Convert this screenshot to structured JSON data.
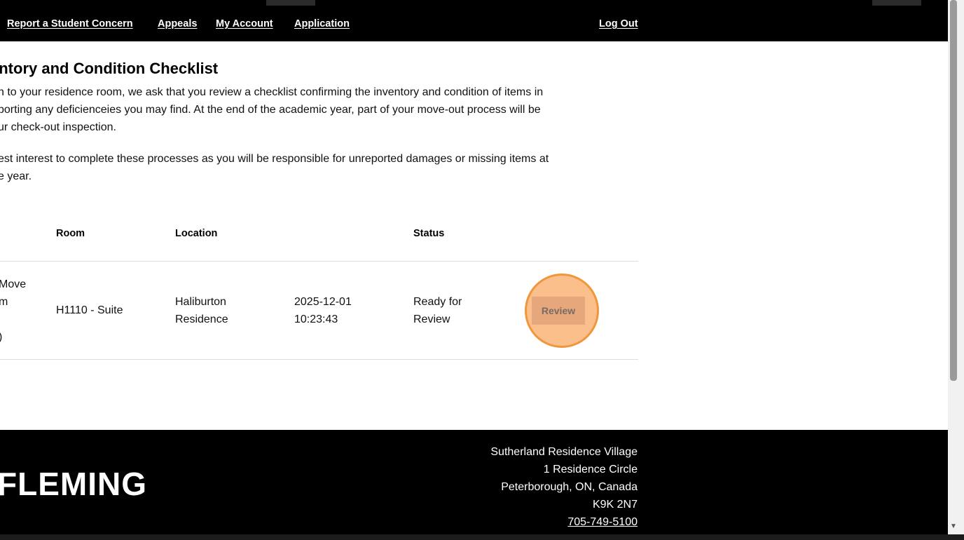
{
  "nav": {
    "report": "Report a Student Concern",
    "appeals": "Appeals",
    "account": "My Account",
    "application": "Application",
    "logout": "Log Out"
  },
  "page": {
    "title": "entory and Condition Checklist",
    "p1_l1": "n to your residence room, we ask that you review a checklist confirming the inventory and condition of items in",
    "p1_l2": "porting any deficienceies you may find. At the end of the academic year, part of your move-out process will be",
    "p1_l3": "ur check-out inspection.",
    "p2_l1": "est interest to complete these processes as you will be responsible for unreported damages or missing items at",
    "p2_l2": "e year."
  },
  "table": {
    "headers": {
      "room": "Room",
      "location": "Location",
      "status": "Status"
    },
    "row": {
      "type_l1": "Move",
      "type_l2": "m",
      "type_l3": ")",
      "room": "H1110 - Suite",
      "location_l1": "Haliburton",
      "location_l2": "Residence",
      "date_l1": "2025-12-01",
      "date_l2": "10:23:43",
      "status_l1": "Ready for",
      "status_l2": "Review",
      "action": "Review"
    }
  },
  "footer": {
    "logo": "FLEMING",
    "addr1": "Sutherland Residence Village",
    "addr2": "1 Residence Circle",
    "addr3": "Peterborough, ON, Canada",
    "addr4": "K9K 2N7",
    "phone": "705-749-5100"
  },
  "colors": {
    "highlight_ring": "#f0963c",
    "header_bg": "#000000"
  }
}
